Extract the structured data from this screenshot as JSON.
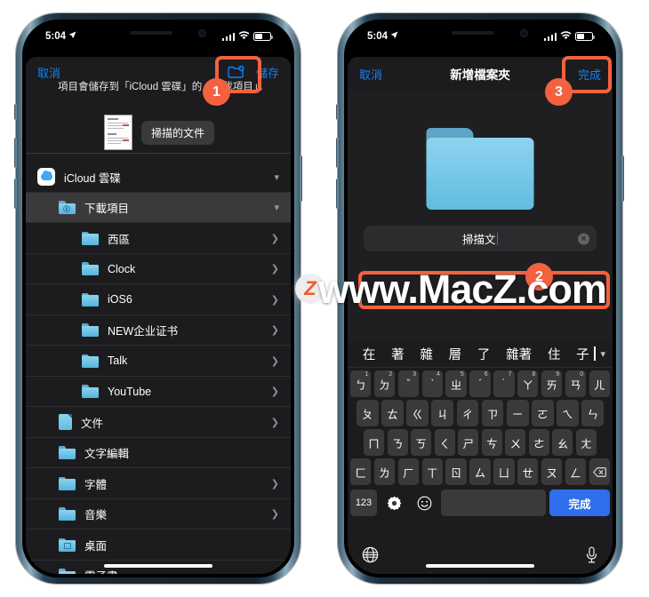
{
  "status_bar": {
    "time": "5:04",
    "location_icon": "location-arrow-icon",
    "signal_icon": "cellular-bars-icon",
    "wifi_icon": "wifi-icon",
    "battery_icon": "battery-icon"
  },
  "left_phone": {
    "toolbar": {
      "cancel": "取消",
      "save": "儲存",
      "new_folder_icon": "new-folder-icon"
    },
    "description": "項目會儲存到「iCloud 雲碟」的「下載項目」。",
    "attachment": {
      "thumbnail_icon": "document-thumbnail",
      "name": "掃描的文件"
    },
    "files": [
      {
        "label": "iCloud 雲碟",
        "icon": "icloud-drive-icon",
        "indent": 0,
        "accessory": "chevron-down",
        "selected": false
      },
      {
        "label": "下載項目",
        "icon": "downloads-folder-icon",
        "indent": 1,
        "accessory": "chevron-down",
        "selected": true
      },
      {
        "label": "西區",
        "icon": "folder-icon",
        "indent": 2,
        "accessory": "chevron-right",
        "selected": false
      },
      {
        "label": "Clock",
        "icon": "folder-icon",
        "indent": 2,
        "accessory": "chevron-right",
        "selected": false
      },
      {
        "label": "iOS6",
        "icon": "folder-icon",
        "indent": 2,
        "accessory": "chevron-right",
        "selected": false
      },
      {
        "label": "NEW企业证书",
        "icon": "folder-icon",
        "indent": 2,
        "accessory": "chevron-right",
        "selected": false
      },
      {
        "label": "Talk",
        "icon": "folder-icon",
        "indent": 2,
        "accessory": "chevron-right",
        "selected": false
      },
      {
        "label": "YouTube",
        "icon": "folder-icon",
        "indent": 2,
        "accessory": "chevron-right",
        "selected": false
      },
      {
        "label": "文件",
        "icon": "documents-folder-icon",
        "indent": 1,
        "accessory": "chevron-right",
        "selected": false
      },
      {
        "label": "文字編輯",
        "icon": "folder-icon",
        "indent": 1,
        "accessory": "",
        "selected": false
      },
      {
        "label": "字體",
        "icon": "folder-icon",
        "indent": 1,
        "accessory": "chevron-right",
        "selected": false
      },
      {
        "label": "音樂",
        "icon": "folder-icon",
        "indent": 1,
        "accessory": "chevron-right",
        "selected": false
      },
      {
        "label": "桌面",
        "icon": "desktop-folder-icon",
        "indent": 1,
        "accessory": "",
        "selected": false
      },
      {
        "label": "電子書",
        "icon": "folder-icon",
        "indent": 1,
        "accessory": "chevron-right",
        "selected": false
      }
    ]
  },
  "right_phone": {
    "toolbar": {
      "cancel": "取消",
      "title": "新增檔案夾",
      "done": "完成"
    },
    "folder_icon": "large-folder-icon",
    "name_field": {
      "value": "掃描文",
      "clear_icon": "clear-text-icon"
    },
    "keyboard": {
      "candidates": [
        "在",
        "著",
        "雜",
        "層",
        "了",
        "雜著",
        "住",
        "子"
      ],
      "expand_icon": "chevron-down-icon",
      "row1": [
        {
          "k": "ㄅ",
          "n": "1"
        },
        {
          "k": "ㄉ",
          "n": "2"
        },
        {
          "k": "ˇ",
          "n": "3"
        },
        {
          "k": "ˋ",
          "n": "4"
        },
        {
          "k": "ㄓ",
          "n": "5"
        },
        {
          "k": "ˊ",
          "n": "6"
        },
        {
          "k": "˙",
          "n": "7"
        },
        {
          "k": "ㄚ",
          "n": "8"
        },
        {
          "k": "ㄞ",
          "n": "9"
        },
        {
          "k": "ㄢ",
          "n": "0"
        },
        {
          "k": "ㄦ",
          "n": ""
        }
      ],
      "row2": [
        "ㄆ",
        "ㄊ",
        "ㄍ",
        "ㄐ",
        "ㄔ",
        "ㄗ",
        "ㄧ",
        "ㄛ",
        "ㄟ",
        "ㄣ"
      ],
      "row3": [
        "ㄇ",
        "ㄋ",
        "ㄎ",
        "ㄑ",
        "ㄕ",
        "ㄘ",
        "ㄨ",
        "ㄜ",
        "ㄠ",
        "ㄤ"
      ],
      "row4": [
        "ㄈ",
        "ㄌ",
        "ㄏ",
        "ㄒ",
        "ㄖ",
        "ㄙ",
        "ㄩ",
        "ㄝ",
        "ㄡ",
        "ㄥ"
      ],
      "backspace_icon": "backspace-icon",
      "numeric_key": "123",
      "settings_icon": "gear-icon",
      "emoji_icon": "emoji-icon",
      "space_key": "",
      "done_key": "完成",
      "globe_icon": "globe-icon",
      "mic_icon": "microphone-icon"
    }
  },
  "annotations": {
    "colors": {
      "highlight": "#f4613f",
      "accent_blue": "#0a84ff",
      "keyboard_blue": "#2f6fed"
    },
    "steps": [
      {
        "number": "1",
        "target": "new-folder-button"
      },
      {
        "number": "2",
        "target": "folder-name-field"
      },
      {
        "number": "3",
        "target": "done-button"
      }
    ]
  },
  "watermark": {
    "logo": "Z",
    "text": "www.MacZ.com"
  }
}
